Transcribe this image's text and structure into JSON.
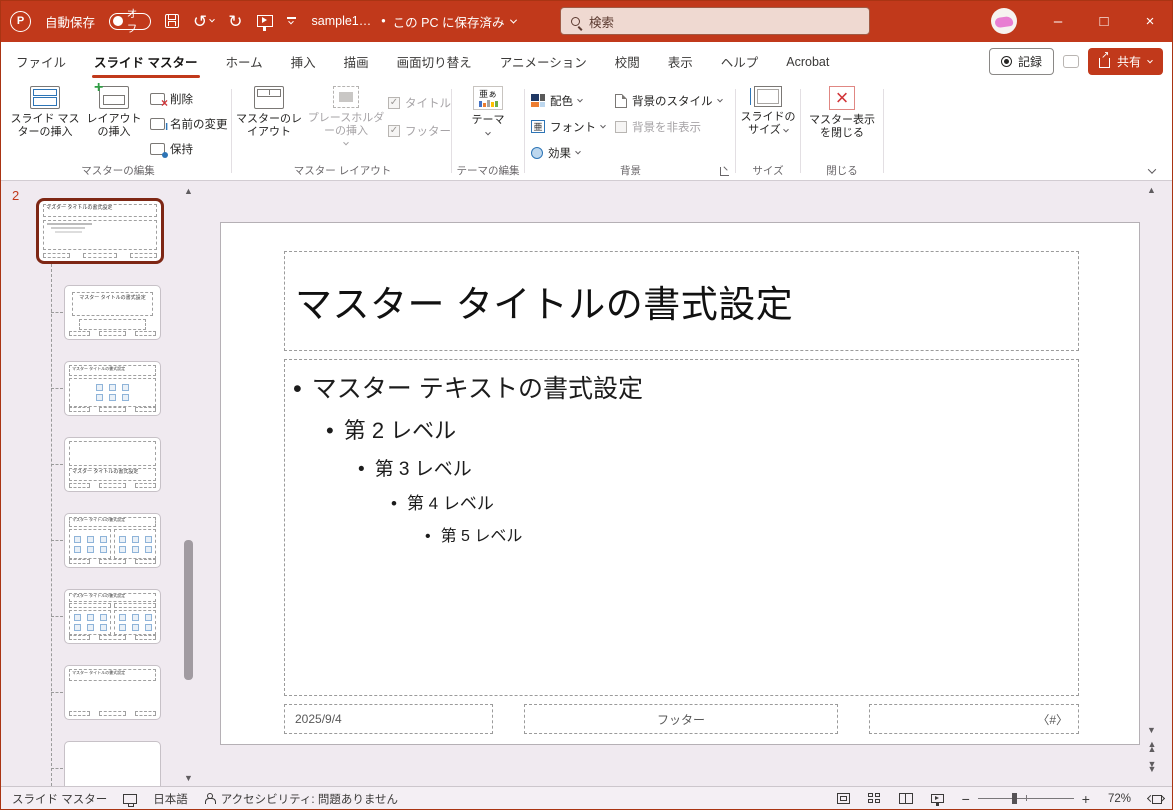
{
  "titlebar": {
    "app_initial": "P",
    "autosave_label": "自動保存",
    "autosave_state": "オフ",
    "filename": "sample1…",
    "saved_bullet": "•",
    "saved_status": "この PC に保存済み",
    "search_placeholder": "検索"
  },
  "window_controls": {
    "minimize": "–",
    "maximize": "□",
    "close": "×"
  },
  "tabs": {
    "items": [
      "ファイル",
      "スライド マスター",
      "ホーム",
      "挿入",
      "描画",
      "画面切り替え",
      "アニメーション",
      "校閲",
      "表示",
      "ヘルプ",
      "Acrobat"
    ],
    "active": "スライド マスター"
  },
  "ribbon": {
    "record_label": "記録",
    "share_label": "共有",
    "groups": {
      "master_edit": {
        "label": "マスターの編集",
        "insert_slide_master": "スライド マスターの挿入",
        "insert_layout": "レイアウトの挿入",
        "delete_btn": "削除",
        "rename_btn": "名前の変更",
        "preserve_btn": "保持"
      },
      "master_layout": {
        "label": "マスター レイアウト",
        "master_layout_btn": "マスターのレイアウト",
        "insert_placeholder_btn": "プレースホルダーの挿入",
        "title_checkbox": "タイトル",
        "footer_checkbox": "フッター",
        "check_glyph": "✓"
      },
      "edit_theme": {
        "label": "テーマの編集",
        "themes_btn": "テーマ",
        "theme_icon_text": "亜ぁ"
      },
      "background": {
        "label": "背景",
        "colors_btn": "配色",
        "fonts_btn": "フォント",
        "effects_btn": "効果",
        "bg_styles_btn": "背景のスタイル",
        "hide_bg_checkbox": "背景を非表示",
        "fonts_icon_text": "亜"
      },
      "size": {
        "label": "サイズ",
        "slide_size_btn": "スライドのサイズ"
      },
      "close": {
        "label": "閉じる",
        "close_master_btn": "マスター表示を閉じる",
        "close_icon_glyph": "×"
      }
    }
  },
  "thumbnail_panel": {
    "slide_number": "2",
    "placeholder_title": "マスター タイトルの書式設定",
    "layouts": [
      {
        "type": "master"
      },
      {
        "type": "title-slide"
      },
      {
        "type": "title-content"
      },
      {
        "type": "section-header"
      },
      {
        "type": "two-content"
      },
      {
        "type": "comparison"
      },
      {
        "type": "title-only"
      },
      {
        "type": "blank"
      }
    ]
  },
  "slide": {
    "title": "マスター タイトルの書式設定",
    "bullets": [
      "マスター テキストの書式設定",
      "第 2 レベル",
      "第 3 レベル",
      "第 4 レベル",
      "第 5 レベル"
    ],
    "date": "2025/9/4",
    "footer": "フッター",
    "slide_number_token": "〈#〉"
  },
  "statusbar": {
    "view_name": "スライド マスター",
    "language": "日本語",
    "accessibility": "アクセシビリティ: 問題ありません",
    "zoom": "72%"
  },
  "colors": {
    "accent": "#c1391b",
    "selected_thumb_border": "#7e2715",
    "theme_bar_colors": [
      "#4472c4",
      "#ed7d31",
      "#a5a5a5",
      "#ffc000",
      "#70ad47"
    ],
    "color_scheme_squares": [
      "#203864",
      "#595959",
      "#ed7d31",
      "#bdd7ee"
    ]
  }
}
